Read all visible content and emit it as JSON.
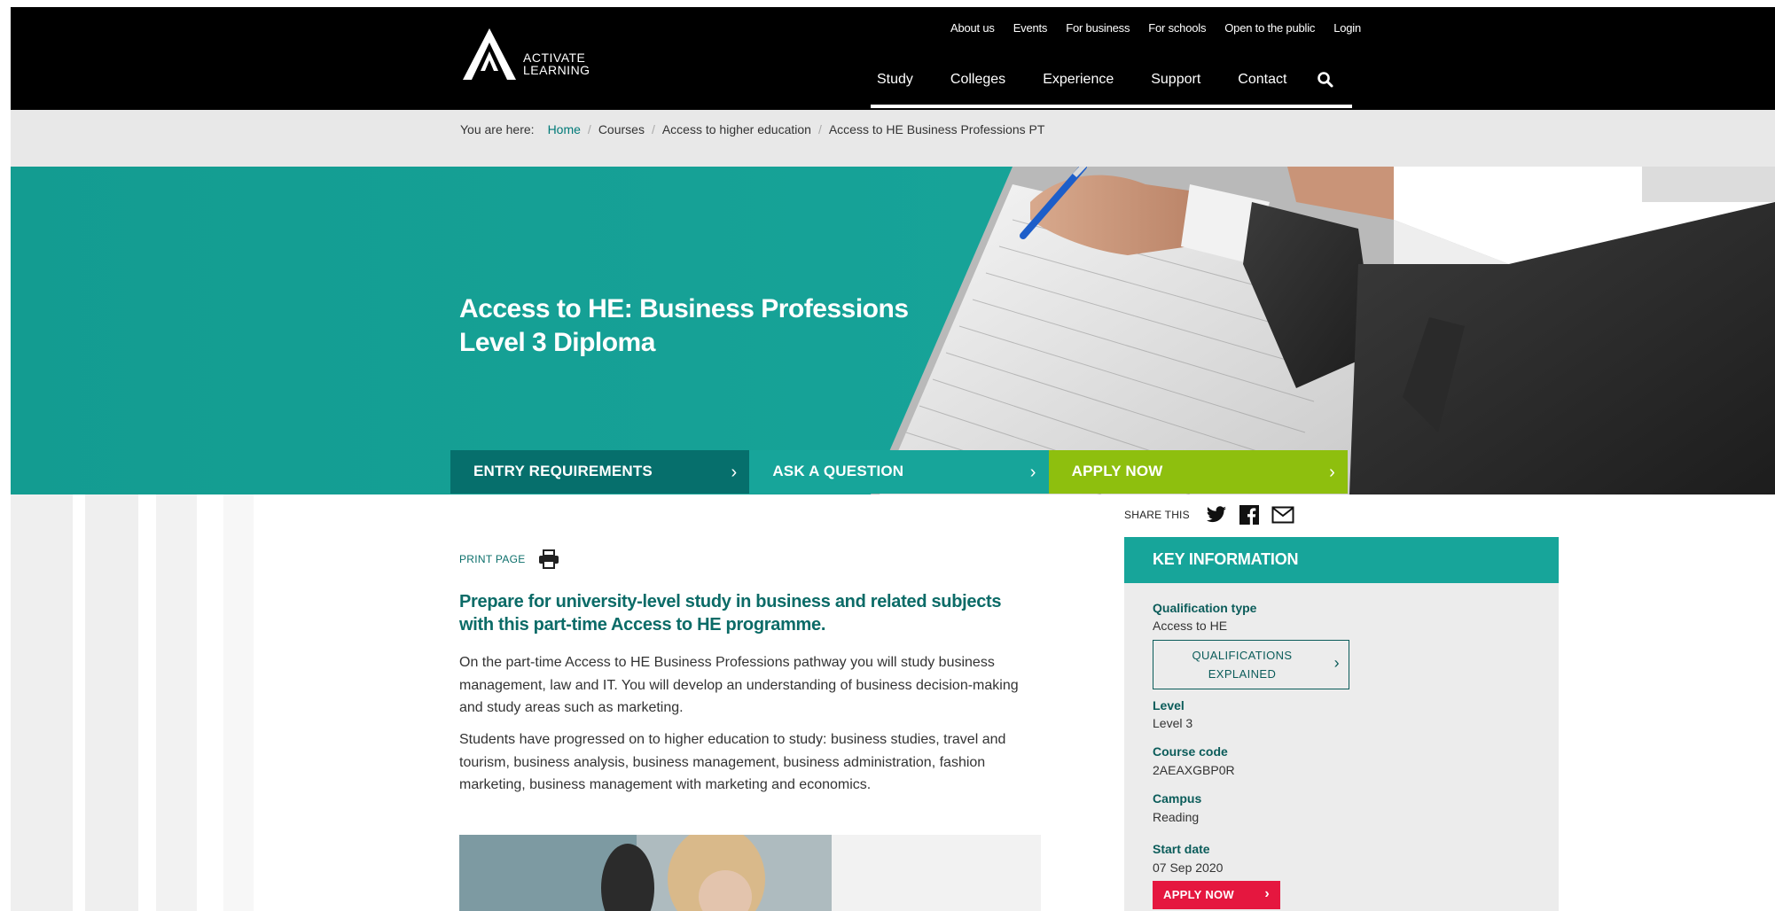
{
  "header": {
    "logo_text_line1": "ACTIVATE",
    "logo_text_line2": "LEARNING",
    "utility_nav": [
      "About us",
      "Events",
      "For business",
      "For schools",
      "Open to the public",
      "Login"
    ],
    "main_nav": [
      "Study",
      "Colleges",
      "Experience",
      "Support",
      "Contact"
    ],
    "search_icon": "search-icon"
  },
  "breadcrumb": {
    "prefix": "You are here:",
    "items": [
      "Home",
      "Courses",
      "Access to higher education",
      "Access to HE Business Professions PT"
    ]
  },
  "hero": {
    "title": "Access to HE: Business Professions Level 3 Diploma",
    "background_color": "#17a59a"
  },
  "cta": {
    "entry_requirements": "ENTRY REQUIREMENTS",
    "ask_question": "ASK A QUESTION",
    "apply_now": "APPLY NOW",
    "chevron": "›"
  },
  "content": {
    "print_page": "PRINT PAGE",
    "intro": "Prepare for university-level study in business and related subjects with this part-time Access to HE programme.",
    "paragraph1": "On the part-time Access to HE Business Professions pathway you will study business management, law and IT. You will develop an understanding of business decision-making and study areas such as marketing.",
    "paragraph2": "Students have progressed on to higher education to study: business studies, travel and tourism, business analysis, business management, business administration, fashion marketing, business management with marketing and economics."
  },
  "share": {
    "label": "SHARE THIS",
    "icons": [
      "twitter-icon",
      "facebook-icon",
      "email-icon"
    ]
  },
  "key_information": {
    "title": "KEY INFORMATION",
    "qualification_type_label": "Qualification type",
    "qualification_type_value": "Access to HE",
    "qualifications_button": "QUALIFICATIONS EXPLAINED",
    "level_label": "Level",
    "level_value": "Level 3",
    "course_code_label": "Course code",
    "course_code_value": "2AEAXGBP0R",
    "campus_label": "Campus",
    "campus_value": "Reading",
    "start_date_label": "Start date",
    "start_date_value": "07 Sep 2020",
    "apply_button": "APPLY NOW"
  },
  "colors": {
    "header_bg": "#000000",
    "teal": "#17a59a",
    "dark_teal": "#066f6c",
    "lime": "#8ebf0e",
    "apply_red": "#e5173f",
    "breadcrumb_bg": "#e8e8e8"
  }
}
